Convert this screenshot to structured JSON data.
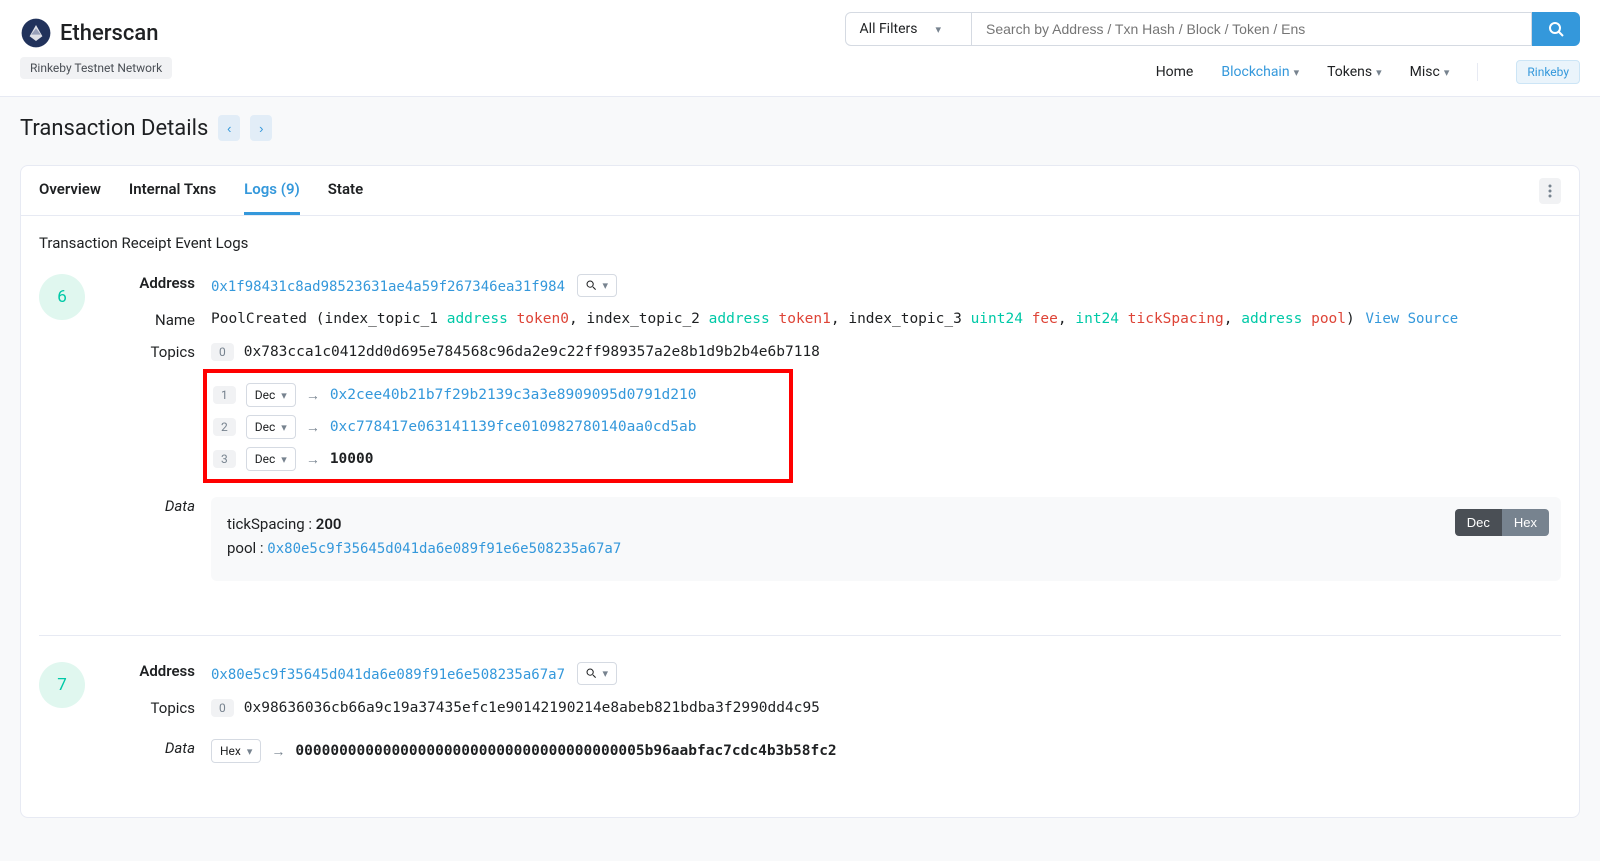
{
  "brand": "Etherscan",
  "network_badge": "Rinkeby Testnet Network",
  "search": {
    "filter_label": "All Filters",
    "placeholder": "Search by Address / Txn Hash / Block / Token / Ens"
  },
  "nav": {
    "home": "Home",
    "blockchain": "Blockchain",
    "tokens": "Tokens",
    "misc": "Misc",
    "rinkeby": "Rinkeby"
  },
  "page_title": "Transaction Details",
  "tabs": {
    "overview": "Overview",
    "internal": "Internal Txns",
    "logs": "Logs (9)",
    "state": "State"
  },
  "section_label": "Transaction Receipt Event Logs",
  "labels": {
    "address": "Address",
    "name": "Name",
    "topics": "Topics",
    "data": "Data",
    "dec": "Dec",
    "hex": "Hex",
    "view_source": "View Source"
  },
  "log6": {
    "index": "6",
    "address": "0x1f98431c8ad98523631ae4a59f267346ea31f984",
    "event": {
      "name": "PoolCreated",
      "params": [
        {
          "prefix": "index_topic_1 ",
          "type": "address",
          "name": "token0"
        },
        {
          "prefix": "index_topic_2 ",
          "type": "address",
          "name": "token1"
        },
        {
          "prefix": "index_topic_3 ",
          "type": "uint24",
          "name": "fee"
        },
        {
          "prefix": "",
          "type": "int24",
          "name": "tickSpacing"
        },
        {
          "prefix": "",
          "type": "address",
          "name": "pool"
        }
      ]
    },
    "topics": {
      "sig": "0x783cca1c0412dd0d695e784568c96da2e9c22ff989357a2e8b1d9b2b4e6b7118",
      "t1": "0x2cee40b21b7f29b2139c3a3e8909095d0791d210",
      "t2": "0xc778417e063141139fce010982780140aa0cd5ab",
      "t3": "10000"
    },
    "data": {
      "tickSpacing": {
        "label": "tickSpacing :",
        "value": "200"
      },
      "pool": {
        "label": "pool :",
        "value": "0x80e5c9f35645d041da6e089f91e6e508235a67a7"
      }
    }
  },
  "log7": {
    "index": "7",
    "address": "0x80e5c9f35645d041da6e089f91e6e508235a67a7",
    "topics": {
      "sig": "0x98636036cb66a9c19a37435efc1e90142190214e8abeb821bdba3f2990dd4c95"
    },
    "data_hex": "0000000000000000000000000000000000000005b96aabfac7cdc4b3b58fc2"
  }
}
